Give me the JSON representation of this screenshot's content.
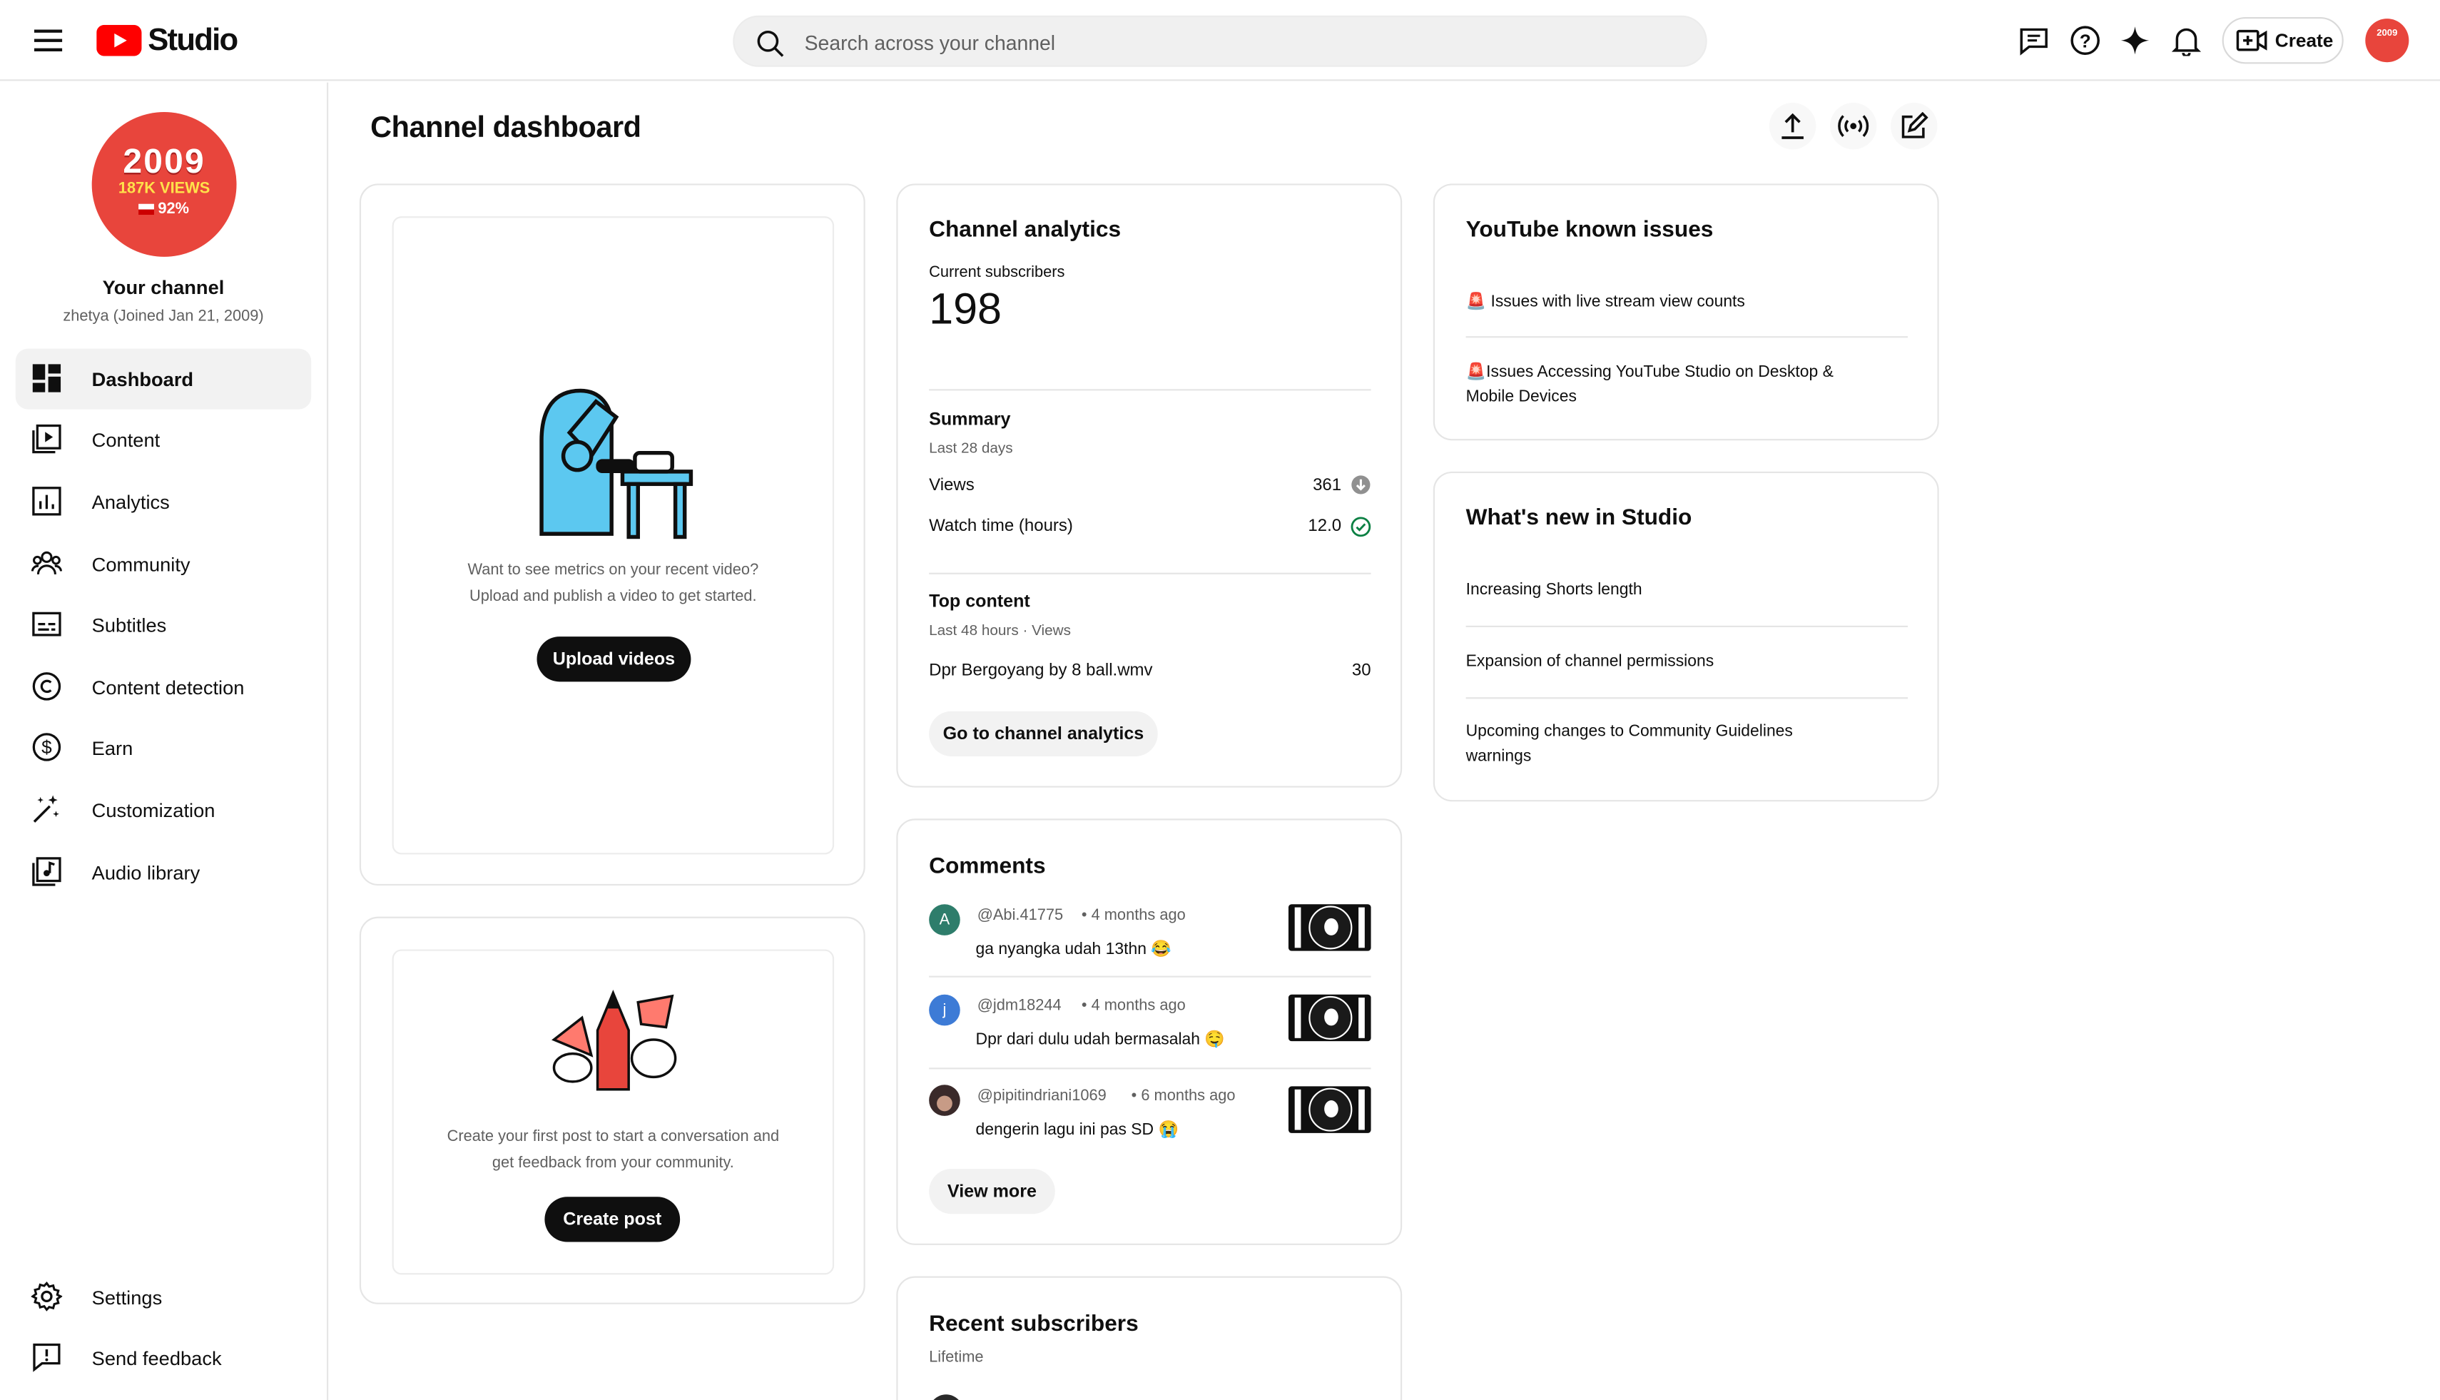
{
  "header": {
    "logo_text": "Studio",
    "search_placeholder": "Search across your channel",
    "create_label": "Create"
  },
  "sidebar": {
    "channel_avatar": {
      "line1": "2009",
      "line2": "187K VIEWS",
      "line3": "92%"
    },
    "channel_name": "Your channel",
    "channel_meta": "zhetya (Joined Jan 21, 2009)",
    "items": [
      {
        "label": "Dashboard",
        "icon": "dashboard-icon",
        "active": true
      },
      {
        "label": "Content",
        "icon": "content-icon"
      },
      {
        "label": "Analytics",
        "icon": "analytics-icon"
      },
      {
        "label": "Community",
        "icon": "community-icon"
      },
      {
        "label": "Subtitles",
        "icon": "subtitles-icon"
      },
      {
        "label": "Content detection",
        "icon": "copyright-icon"
      },
      {
        "label": "Earn",
        "icon": "dollar-icon"
      },
      {
        "label": "Customization",
        "icon": "magic-wand-icon"
      },
      {
        "label": "Audio library",
        "icon": "audio-library-icon"
      }
    ],
    "settings_label": "Settings",
    "feedback_label": "Send feedback"
  },
  "main": {
    "title": "Channel dashboard",
    "upload_card": {
      "text_line1": "Want to see metrics on your recent video?",
      "text_line2": "Upload and publish a video to get started.",
      "button": "Upload videos"
    },
    "post_card": {
      "text_line1": "Create your first post to start a conversation and",
      "text_line2": "get feedback from your community.",
      "button": "Create post"
    },
    "analytics": {
      "title": "Channel analytics",
      "subs_label": "Current subscribers",
      "subs_value": "198",
      "summary_title": "Summary",
      "summary_period": "Last 28 days",
      "rows": [
        {
          "label": "Views",
          "value": "361",
          "status": "down"
        },
        {
          "label": "Watch time (hours)",
          "value": "12.0",
          "status": "ok"
        }
      ],
      "top_title": "Top content",
      "top_period": "Last 48 hours · Views",
      "top_item": {
        "label": "Dpr Bergoyang by 8 ball.wmv",
        "value": "30"
      },
      "button": "Go to channel analytics"
    },
    "comments": {
      "title": "Comments",
      "items": [
        {
          "author": "@Abi.41775",
          "time": "• 4 months ago",
          "text": "ga nyangka udah 13thn 😂",
          "avatar": "A",
          "color": "#2e7d6b"
        },
        {
          "author": "@jdm18244",
          "time": "• 4 months ago",
          "text": "Dpr dari dulu udah bermasalah 🤤",
          "avatar": "j",
          "color": "#3d7bd6"
        },
        {
          "author": "@pipitindriani1069",
          "time": "• 6 months ago",
          "text": "dengerin lagu ini pas SD 😭",
          "avatar": "",
          "color": "#3a2a2a"
        }
      ],
      "button": "View more"
    },
    "subscribers": {
      "title": "Recent subscribers",
      "period": "Lifetime"
    },
    "known_issues": {
      "title": "YouTube known issues",
      "items": [
        "🚨 Issues with live stream view counts",
        "🚨Issues Accessing YouTube Studio on Desktop & Mobile Devices"
      ]
    },
    "whats_new": {
      "title": "What's new in Studio",
      "items": [
        "Increasing Shorts length",
        "Expansion of channel permissions",
        "Upcoming changes to Community Guidelines warnings"
      ]
    }
  },
  "colors": {
    "brand_red": "#ff0000",
    "avatar_red": "#e8453c",
    "ok_green": "#0b8043"
  }
}
